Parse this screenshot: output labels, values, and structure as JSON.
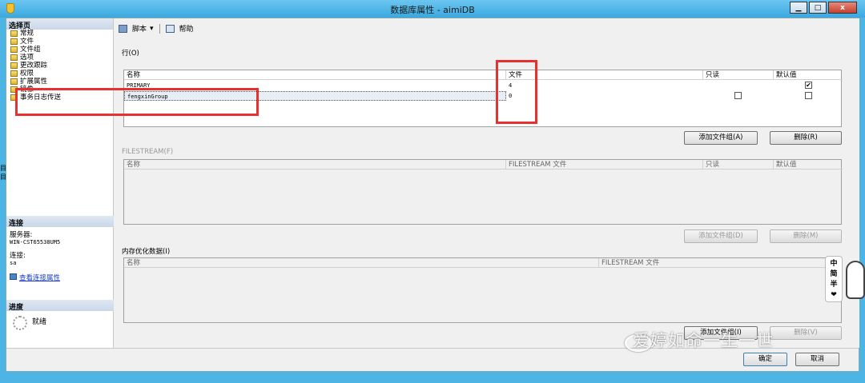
{
  "window": {
    "title": "数据库属性 - aimiDB",
    "min": "▁",
    "max": "□",
    "close": "x"
  },
  "nav": {
    "header": "选择页",
    "items": [
      "常规",
      "文件",
      "文件组",
      "选项",
      "更改跟踪",
      "权限",
      "扩展属性",
      "镜像",
      "事务日志传送"
    ]
  },
  "connection": {
    "header": "连接",
    "server_label": "服务器:",
    "server_value": "WIN-CST65538UM5",
    "conn_label": "连接:",
    "conn_value": "sa",
    "view_link": "查看连接属性"
  },
  "progress": {
    "header": "进度",
    "status": "就绪"
  },
  "toolbar": {
    "script": "脚本",
    "dropdown": "▾",
    "help": "帮助"
  },
  "rows_section": {
    "label": "行(O)",
    "columns": [
      "名称",
      "文件",
      "只读",
      "默认值"
    ],
    "rows": [
      {
        "name": "PRIMARY",
        "files": "4",
        "readonly": null,
        "default": true
      },
      {
        "name": "fengxinGroup",
        "files": "0",
        "readonly": false,
        "default": false
      }
    ],
    "add_button": "添加文件组(A)",
    "delete_button": "删除(R)"
  },
  "filestream_section": {
    "label": "FILESTREAM(F)",
    "columns": [
      "名称",
      "FILESTREAM 文件",
      "只读",
      "默认值"
    ],
    "add_button": "添加文件组(D)",
    "delete_button": "删除(M)"
  },
  "memory_section": {
    "label": "内存优化数据(I)",
    "columns": [
      "名称",
      "FILESTREAM 文件"
    ],
    "add_button": "添加文件组(I)",
    "delete_button": "删除(V)"
  },
  "footer": {
    "ok": "确定",
    "cancel": "取消"
  },
  "watermark": "爱婷如命一生一世",
  "side_badge": [
    "中",
    "简",
    "半",
    "❤"
  ],
  "left_edge": [
    "目",
    "目"
  ],
  "colors": {
    "highlight": "#e8302f",
    "titlebar": "#4db4e6"
  }
}
